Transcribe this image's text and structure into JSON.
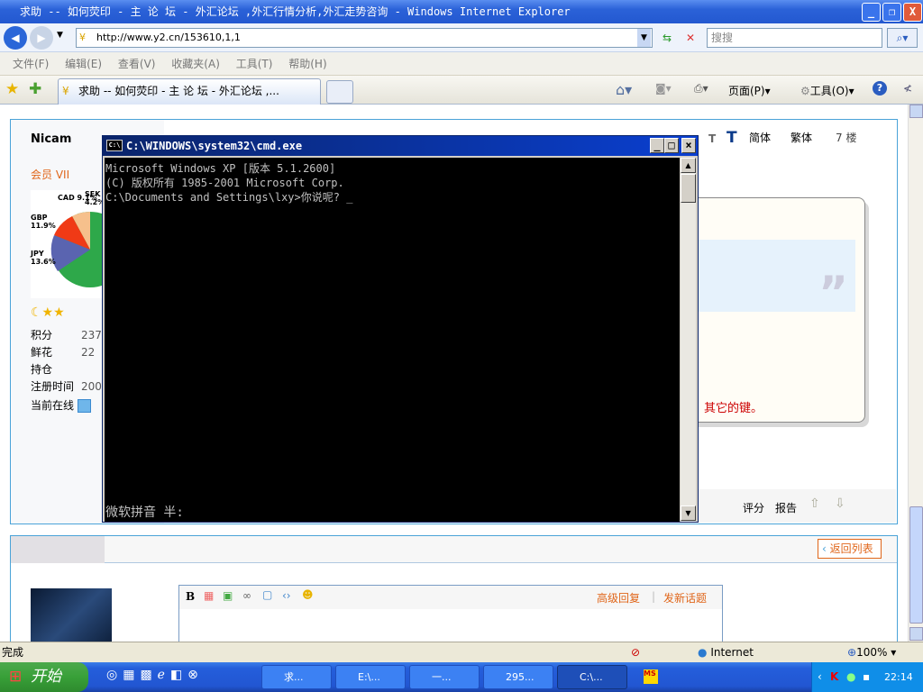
{
  "window": {
    "title": "求助 -- 如何荧印 - 主 论 坛 - 外汇论坛 ,外汇行情分析,外汇走势咨询 - Windows Internet Explorer"
  },
  "address": {
    "url": "http://www.y2.cn/153610,1,1",
    "search_placeholder": "搜搜"
  },
  "menu": [
    "文件(F)",
    "编辑(E)",
    "查看(V)",
    "收藏夹(A)",
    "工具(T)",
    "帮助(H)"
  ],
  "tab": {
    "label": "求助 -- 如何荧印 - 主 论 坛 - 外汇论坛 ,..."
  },
  "commandbar": {
    "page": "页面(P)",
    "tools": "工具(O)"
  },
  "post": {
    "username": "Nicam",
    "rank": "会员 VII",
    "pie_labels": [
      "CAD 9.1%",
      "SEK 4.2%",
      "GBP 11.9%",
      "JPY 13.6%"
    ],
    "stats": [
      {
        "k": "积分",
        "v": "237"
      },
      {
        "k": "鲜花",
        "v": "22"
      },
      {
        "k": "持仓",
        "v": ""
      },
      {
        "k": "注册时间",
        "v": "200"
      }
    ],
    "online": "当前在线",
    "header_links": [
      "简体",
      "繁体"
    ],
    "floor": "7 楼",
    "red_text": "其它的键。",
    "footer": [
      "评分",
      "报告"
    ]
  },
  "reply": {
    "back": "返回列表",
    "advanced": "高级回复",
    "new_topic": "发新话题"
  },
  "cmd": {
    "title": "C:\\WINDOWS\\system32\\cmd.exe",
    "lines": [
      "Microsoft Windows XP [版本 5.1.2600]",
      "(C) 版权所有 1985-2001 Microsoft Corp.",
      "",
      "C:\\Documents and Settings\\lxy>你说呢? _"
    ],
    "ime": "微软拼音 半:"
  },
  "status": {
    "text": "完成",
    "zone": "Internet",
    "zoom": "100%"
  },
  "taskbar": {
    "start": "开始",
    "buttons": [
      "求...",
      "E:\\...",
      "一...",
      "295...",
      "C:\\..."
    ],
    "clock": "22:14"
  }
}
